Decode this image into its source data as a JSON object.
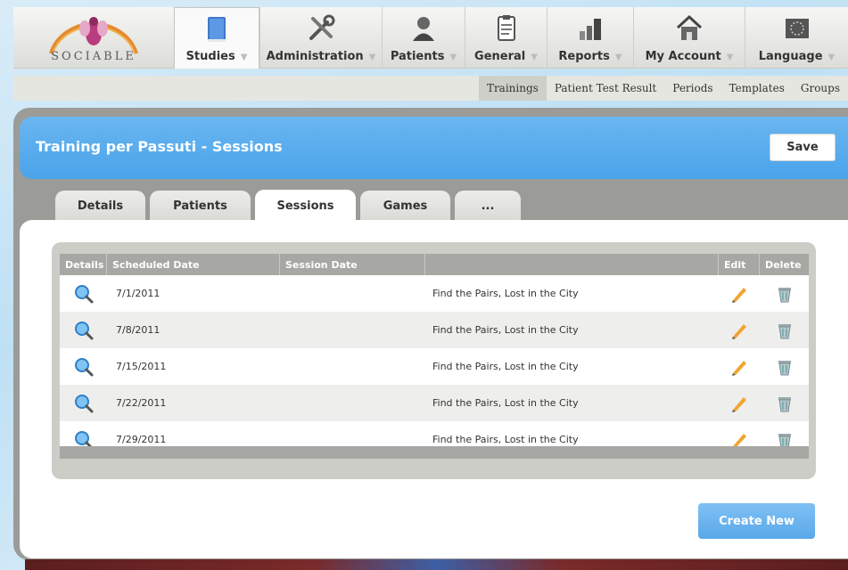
{
  "brand": {
    "name": "SOCIABLE"
  },
  "nav": {
    "items": [
      {
        "label": "Studies",
        "icon": "book-icon",
        "active": true
      },
      {
        "label": "Administration",
        "icon": "tools-icon"
      },
      {
        "label": "Patients",
        "icon": "person-icon"
      },
      {
        "label": "General",
        "icon": "clipboard-icon"
      },
      {
        "label": "Reports",
        "icon": "bar-chart-icon"
      },
      {
        "label": "My Account",
        "icon": "house-icon"
      },
      {
        "label": "Language",
        "icon": "eu-flag-icon"
      }
    ]
  },
  "subnav": {
    "items": [
      "Trainings",
      "Patient Test Result",
      "Periods",
      "Templates",
      "Groups"
    ],
    "active": "Trainings"
  },
  "page": {
    "title": "Training per Passuti - Sessions",
    "save_label": "Save",
    "create_label": "Create New"
  },
  "tabs": [
    "Details",
    "Patients",
    "Sessions",
    "Games",
    "..."
  ],
  "active_tab": "Sessions",
  "grid": {
    "headers": [
      "Details",
      "Scheduled Date",
      "Session Date",
      "",
      "Edit",
      "Delete"
    ],
    "rows": [
      {
        "scheduled": "7/1/2011",
        "session": "",
        "games": "Find the Pairs, Lost in the City"
      },
      {
        "scheduled": "7/8/2011",
        "session": "",
        "games": "Find the Pairs, Lost in the City"
      },
      {
        "scheduled": "7/15/2011",
        "session": "",
        "games": "Find the Pairs, Lost in the City"
      },
      {
        "scheduled": "7/22/2011",
        "session": "",
        "games": "Find the Pairs, Lost in the City"
      },
      {
        "scheduled": "7/29/2011",
        "session": "",
        "games": "Find the Pairs, Lost in the City"
      }
    ]
  },
  "colors": {
    "accent": "#4aa3ea",
    "panel": "#9b9b98",
    "grid_header": "#a7a7a3"
  }
}
